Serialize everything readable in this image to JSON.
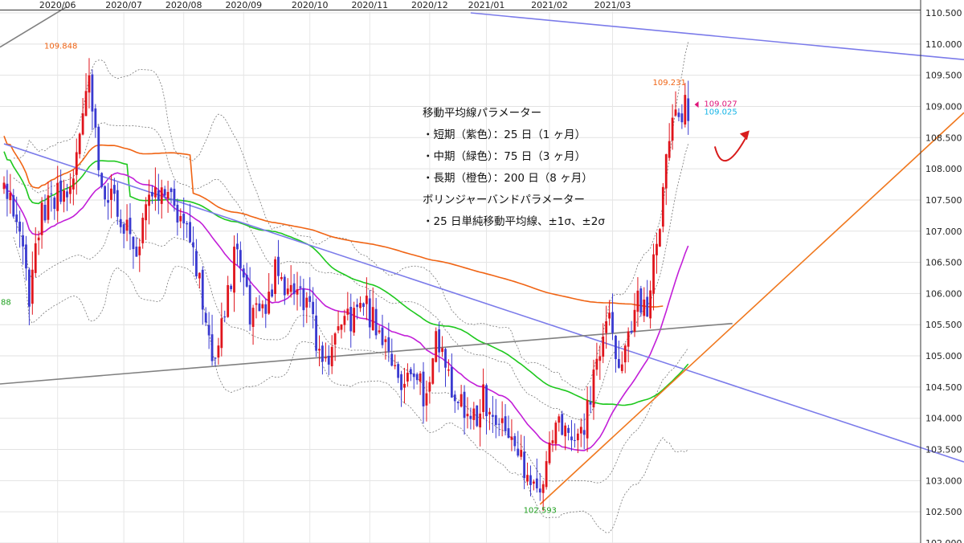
{
  "chart_data": {
    "type": "candlestick",
    "x_ticks": [
      "2020/06",
      "2020/07",
      "2020/08",
      "2020/09",
      "2020/10",
      "2020/11",
      "2020/12",
      "2021/01",
      "2021/02",
      "2021/03"
    ],
    "y_ticks": [
      "110.500",
      "110.000",
      "109.500",
      "109.000",
      "108.500",
      "108.000",
      "107.500",
      "107.000",
      "106.500",
      "106.000",
      "105.500",
      "105.000",
      "104.500",
      "104.000",
      "103.500",
      "103.000",
      "102.500",
      "102.000"
    ],
    "ylim": [
      102.0,
      110.5
    ],
    "grid": true,
    "price_labels": {
      "high_2020_06": "109.848",
      "low_2021_01": "102.593",
      "high_2021_03": "109.231",
      "current_close": "109.027",
      "current_alt": "109.025",
      "left_edge": "88"
    },
    "legend_lines": [
      "移動平均線パラメーター",
      "・短期（紫色）：25 日（1 ヶ月）",
      "・中期（緑色）：75 日（3 ヶ月）",
      "・長期（橙色）：200 日（8 ヶ月）",
      "ボリンジャーバンドパラメーター",
      "・25 日単純移動平均線、±1σ、±2σ"
    ],
    "series_colors": {
      "up": "#e0141c",
      "down": "#3a3ad0",
      "ma25": "#c21ed8",
      "ma75": "#1ec81e",
      "ma200": "#f06414",
      "bollinger": "#777777",
      "trend_blue": "#7b7bea",
      "trend_orange": "#f0781e",
      "trend_gray": "#808080",
      "arrow": "#d81c1c",
      "label_orange": "#f06414",
      "label_green": "#1ea01e",
      "label_pink": "#e0147a",
      "label_cyan": "#14b4e6"
    },
    "ohlc_anchors": [
      [
        0,
        107.7
      ],
      [
        4,
        107.2
      ],
      [
        8,
        106.0
      ],
      [
        12,
        107.3
      ],
      [
        16,
        107.6
      ],
      [
        20,
        107.4
      ],
      [
        24,
        108.5
      ],
      [
        27,
        109.6
      ],
      [
        30,
        108.0
      ],
      [
        34,
        107.5
      ],
      [
        38,
        107.2
      ],
      [
        42,
        106.7
      ],
      [
        46,
        107.8
      ],
      [
        50,
        107.5
      ],
      [
        54,
        107.4
      ],
      [
        58,
        107.3
      ],
      [
        60,
        106.8
      ],
      [
        63,
        105.8
      ],
      [
        66,
        105.0
      ],
      [
        70,
        105.8
      ],
      [
        74,
        106.8
      ],
      [
        78,
        105.6
      ],
      [
        82,
        105.6
      ],
      [
        86,
        106.3
      ],
      [
        90,
        106.0
      ],
      [
        94,
        106.0
      ],
      [
        98,
        105.5
      ],
      [
        102,
        104.8
      ],
      [
        106,
        105.5
      ],
      [
        110,
        105.6
      ],
      [
        114,
        105.9
      ],
      [
        118,
        105.5
      ],
      [
        122,
        105.2
      ],
      [
        126,
        104.5
      ],
      [
        130,
        104.8
      ],
      [
        134,
        104.2
      ],
      [
        137,
        105.3
      ],
      [
        140,
        104.8
      ],
      [
        144,
        104.3
      ],
      [
        148,
        103.9
      ],
      [
        152,
        104.3
      ],
      [
        156,
        104.0
      ],
      [
        160,
        103.6
      ],
      [
        164,
        103.3
      ],
      [
        168,
        103.0
      ],
      [
        170,
        102.8
      ],
      [
        174,
        103.8
      ],
      [
        178,
        104.0
      ],
      [
        182,
        103.6
      ],
      [
        186,
        104.3
      ],
      [
        190,
        105.3
      ],
      [
        192,
        105.5
      ],
      [
        196,
        104.8
      ],
      [
        200,
        105.8
      ],
      [
        204,
        105.8
      ],
      [
        206,
        106.6
      ],
      [
        208,
        107.2
      ],
      [
        210,
        108.2
      ],
      [
        212,
        109.0
      ],
      [
        214,
        108.6
      ],
      [
        216,
        109.0
      ]
    ]
  }
}
